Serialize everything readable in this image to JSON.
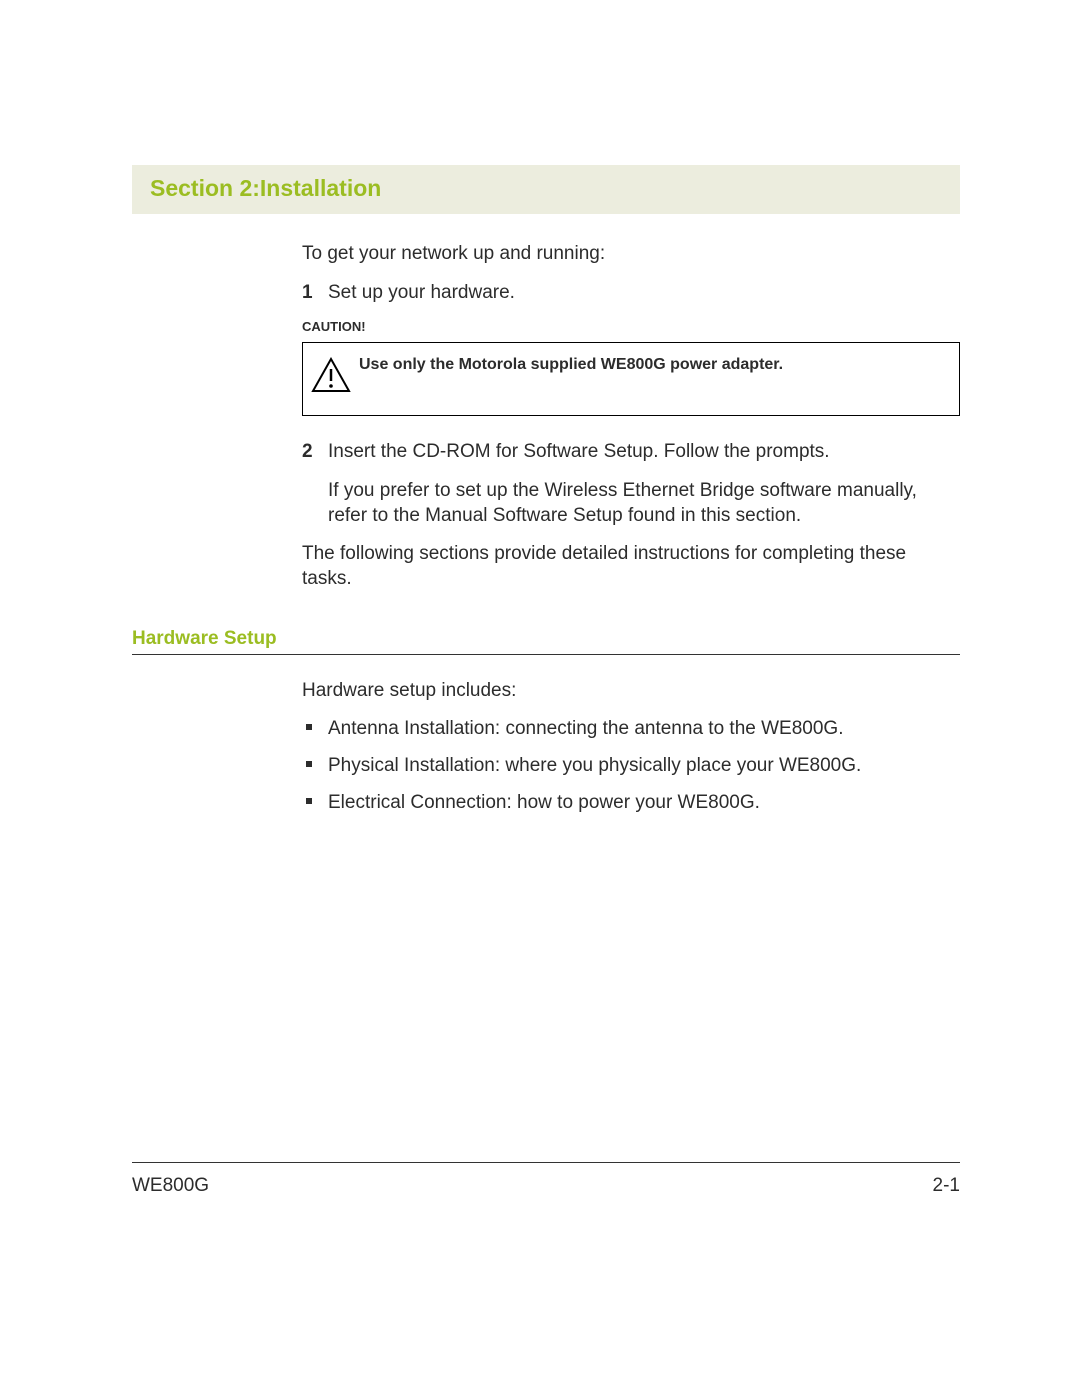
{
  "section_title": "Section 2:Installation",
  "intro": "To get your network up and running:",
  "steps": [
    {
      "num": "1",
      "text": "Set up your hardware."
    },
    {
      "num": "2",
      "text": "Insert the CD-ROM for Software Setup. Follow the prompts."
    }
  ],
  "caution": {
    "label": "CAUTION!",
    "message": "Use only the Motorola supplied WE800G power adapter."
  },
  "step2_followup": "If you prefer to set up the Wireless Ethernet Bridge software manually, refer to the Manual Software Setup found in this section.",
  "closing": "The following sections provide detailed instructions for completing these tasks.",
  "subhead": "Hardware Setup",
  "hw_intro": "Hardware setup includes:",
  "hw_bullets": [
    "Antenna Installation: connecting the antenna to the WE800G.",
    "Physical Installation: where you physically place your WE800G.",
    "Electrical Connection: how to power your WE800G."
  ],
  "footer": {
    "model": "WE800G",
    "page": "2-1"
  }
}
